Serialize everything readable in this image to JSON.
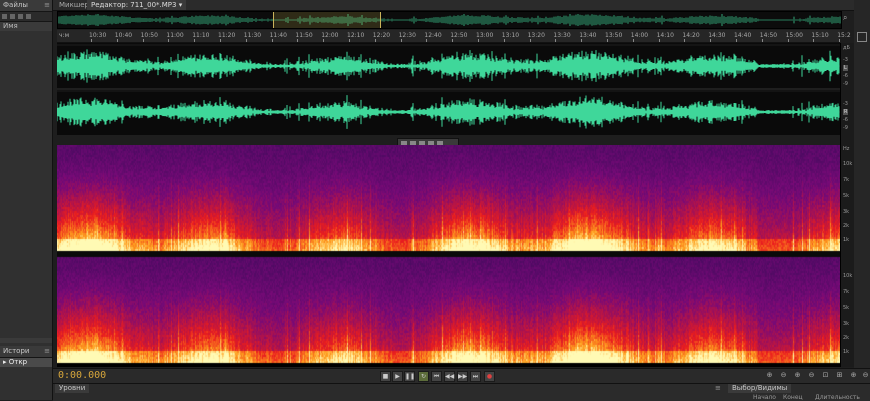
{
  "left_panel": {
    "top_tab": "Файлы",
    "file_item": "Имя",
    "bottom_tab": "Истори",
    "history_item": "Откр"
  },
  "doc_tabs": [
    {
      "label": "Микшер"
    },
    {
      "label": "Редактор: 711_00*.MP3"
    }
  ],
  "ruler": {
    "unit": "ч:м",
    "ticks": [
      "10:30",
      "10:40",
      "10:50",
      "11:00",
      "11:10",
      "11:20",
      "11:30",
      "11:40",
      "11:50",
      "12:00",
      "12:10",
      "12:20",
      "12:30",
      "12:40",
      "12:50",
      "13:00",
      "13:10",
      "13:20",
      "13:30",
      "13:40",
      "13:50",
      "14:00",
      "14:10",
      "14:20",
      "14:30",
      "14:40",
      "14:50",
      "15:00",
      "15:10",
      "15:2"
    ]
  },
  "scale": {
    "wave_unit": "дБ",
    "wave_labels": [
      "-3",
      "-6",
      "-9",
      "-3",
      "-6",
      "-9"
    ],
    "spec_unit": "Hz",
    "spec_labels": [
      "10k",
      "7k",
      "5k",
      "3k",
      "2k",
      "1k",
      "10k",
      "7k",
      "5k",
      "3k",
      "2k",
      "1k"
    ],
    "channel_l": "L",
    "channel_r": "R"
  },
  "transport": {
    "time": "0:00.000"
  },
  "bottom": {
    "tab_left": "Уровни",
    "tab_right": "Выбор/Видимы",
    "cols": [
      "Начало",
      "Конец",
      "Длительность"
    ]
  },
  "colors": {
    "waveform": "#3fd79a",
    "timecode": "#d7a63b",
    "selection": "#c9b35a"
  }
}
